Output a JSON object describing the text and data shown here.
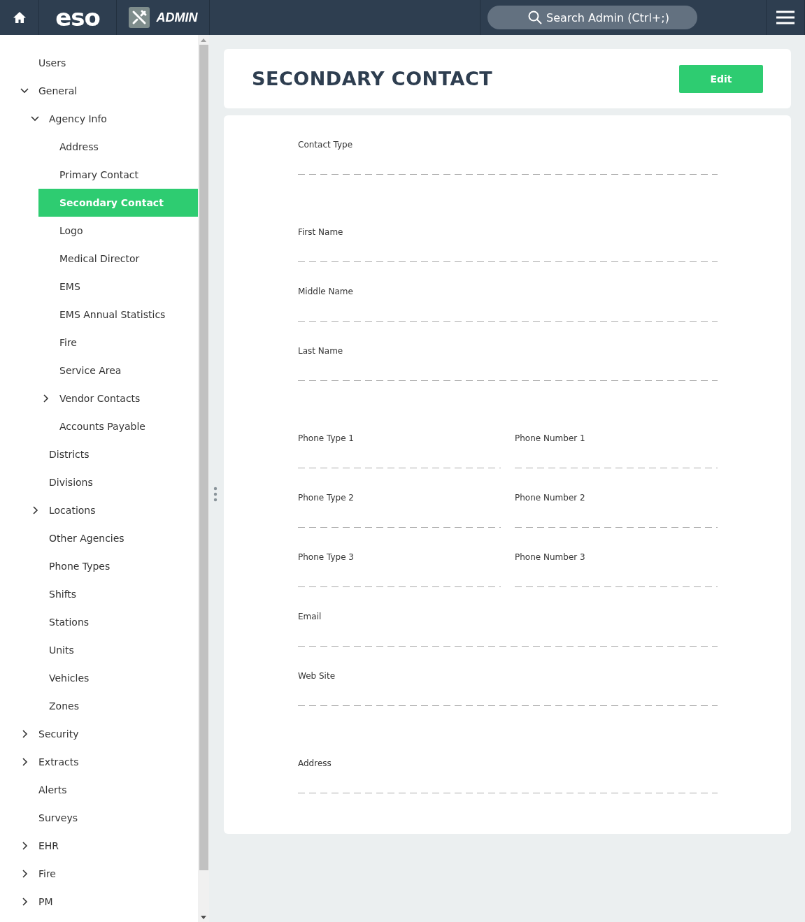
{
  "header": {
    "logo": "eso",
    "app_name": "ADMIN",
    "search": {
      "placeholder": "Search Admin (Ctrl+;)"
    }
  },
  "sidebar": {
    "items": [
      {
        "label": "Users",
        "kind": "leaf",
        "selected": false
      },
      {
        "label": "General",
        "kind": "branch",
        "expanded": true,
        "selected": false,
        "children": [
          {
            "label": "Agency Info",
            "kind": "branch",
            "expanded": true,
            "selected": false,
            "children": [
              {
                "label": "Address",
                "kind": "leaf",
                "selected": false
              },
              {
                "label": "Primary Contact",
                "kind": "leaf",
                "selected": false
              },
              {
                "label": "Secondary Contact",
                "kind": "leaf",
                "selected": true
              },
              {
                "label": "Logo",
                "kind": "leaf",
                "selected": false
              },
              {
                "label": "Medical Director",
                "kind": "leaf",
                "selected": false
              },
              {
                "label": "EMS",
                "kind": "leaf",
                "selected": false
              },
              {
                "label": "EMS Annual Statistics",
                "kind": "leaf",
                "selected": false
              },
              {
                "label": "Fire",
                "kind": "leaf",
                "selected": false
              },
              {
                "label": "Service Area",
                "kind": "leaf",
                "selected": false
              },
              {
                "label": "Vendor Contacts",
                "kind": "branch",
                "expanded": false,
                "selected": false
              },
              {
                "label": "Accounts Payable",
                "kind": "leaf",
                "selected": false
              }
            ]
          },
          {
            "label": "Districts",
            "kind": "leaf",
            "selected": false
          },
          {
            "label": "Divisions",
            "kind": "leaf",
            "selected": false
          },
          {
            "label": "Locations",
            "kind": "branch",
            "expanded": false,
            "selected": false
          },
          {
            "label": "Other Agencies",
            "kind": "leaf",
            "selected": false
          },
          {
            "label": "Phone Types",
            "kind": "leaf",
            "selected": false
          },
          {
            "label": "Shifts",
            "kind": "leaf",
            "selected": false
          },
          {
            "label": "Stations",
            "kind": "leaf",
            "selected": false
          },
          {
            "label": "Units",
            "kind": "leaf",
            "selected": false
          },
          {
            "label": "Vehicles",
            "kind": "leaf",
            "selected": false
          },
          {
            "label": "Zones",
            "kind": "leaf",
            "selected": false
          }
        ]
      },
      {
        "label": "Security",
        "kind": "branch",
        "expanded": false,
        "selected": false
      },
      {
        "label": "Extracts",
        "kind": "branch",
        "expanded": false,
        "selected": false
      },
      {
        "label": "Alerts",
        "kind": "leaf",
        "selected": false
      },
      {
        "label": "Surveys",
        "kind": "leaf",
        "selected": false
      },
      {
        "label": "EHR",
        "kind": "branch",
        "expanded": false,
        "selected": false
      },
      {
        "label": "Fire",
        "kind": "branch",
        "expanded": false,
        "selected": false
      },
      {
        "label": "PM",
        "kind": "branch",
        "expanded": false,
        "selected": false
      }
    ]
  },
  "page": {
    "title": "SECONDARY CONTACT",
    "edit_button": "Edit",
    "sections": [
      {
        "rows": [
          [
            {
              "label": "Contact Type"
            }
          ]
        ]
      },
      {
        "rows": [
          [
            {
              "label": "First Name"
            }
          ],
          [
            {
              "label": "Middle Name"
            }
          ],
          [
            {
              "label": "Last Name"
            }
          ]
        ]
      },
      {
        "rows": [
          [
            {
              "label": "Phone Type 1"
            },
            {
              "label": "Phone Number 1"
            }
          ],
          [
            {
              "label": "Phone Type 2"
            },
            {
              "label": "Phone Number 2"
            }
          ],
          [
            {
              "label": "Phone Type 3"
            },
            {
              "label": "Phone Number 3"
            }
          ],
          [
            {
              "label": "Email"
            }
          ],
          [
            {
              "label": "Web Site"
            }
          ]
        ]
      },
      {
        "rows": [
          [
            {
              "label": "Address"
            }
          ]
        ]
      }
    ]
  }
}
